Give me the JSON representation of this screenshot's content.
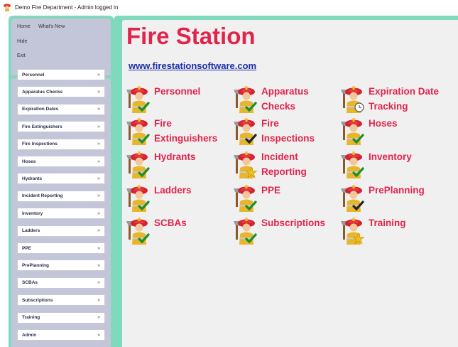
{
  "window": {
    "title": "Demo Fire Department - Admin logged in"
  },
  "sidebar": {
    "top_links": [
      "Home",
      "What's New",
      "Hide",
      "Exit"
    ],
    "sections": [
      "Personnel",
      "Apparatus Checks",
      "Expiration Dates",
      "Fire Extinguishers",
      "Fire Inspections",
      "Hoses",
      "Hydrants",
      "Incident Reporting",
      "Inventory",
      "Ladders",
      "PPE",
      "PrePlanning",
      "SCBAs",
      "Subscriptions",
      "Training",
      "Admin"
    ],
    "chevron": "»"
  },
  "main": {
    "title": "Fire Station",
    "website": "www.firestationsoftware.com",
    "modules": [
      {
        "label": "Personnel",
        "badge": "green-check"
      },
      {
        "label": "Apparatus\nChecks",
        "badge": "green-check"
      },
      {
        "label": "Expiration Date\nTracking",
        "badge": "clock"
      },
      {
        "label": "Fire\nExtinguishers",
        "badge": "green-check"
      },
      {
        "label": "Fire\nInspections",
        "badge": "black-check"
      },
      {
        "label": "Hoses",
        "badge": "green-check"
      },
      {
        "label": "Hydrants",
        "badge": "green-check"
      },
      {
        "label": "Incident\nReporting",
        "badge": "star"
      },
      {
        "label": "Inventory",
        "badge": "green-check"
      },
      {
        "label": "Ladders",
        "badge": "green-check"
      },
      {
        "label": "PPE",
        "badge": "green-check"
      },
      {
        "label": "PrePlanning",
        "badge": "black-check"
      },
      {
        "label": "SCBAs",
        "badge": "green-check"
      },
      {
        "label": "Subscriptions",
        "badge": "green-check"
      },
      {
        "label": "Training",
        "badge": "star"
      }
    ]
  },
  "colors": {
    "accent": "#e2244c",
    "link": "#1a2ea8",
    "frame": "#7fd9bd",
    "sidebar": "#c3c5d9",
    "panel": "#f0f0f0"
  },
  "icons": {
    "app": "firefighter-icon",
    "module": "firefighter-icon"
  }
}
